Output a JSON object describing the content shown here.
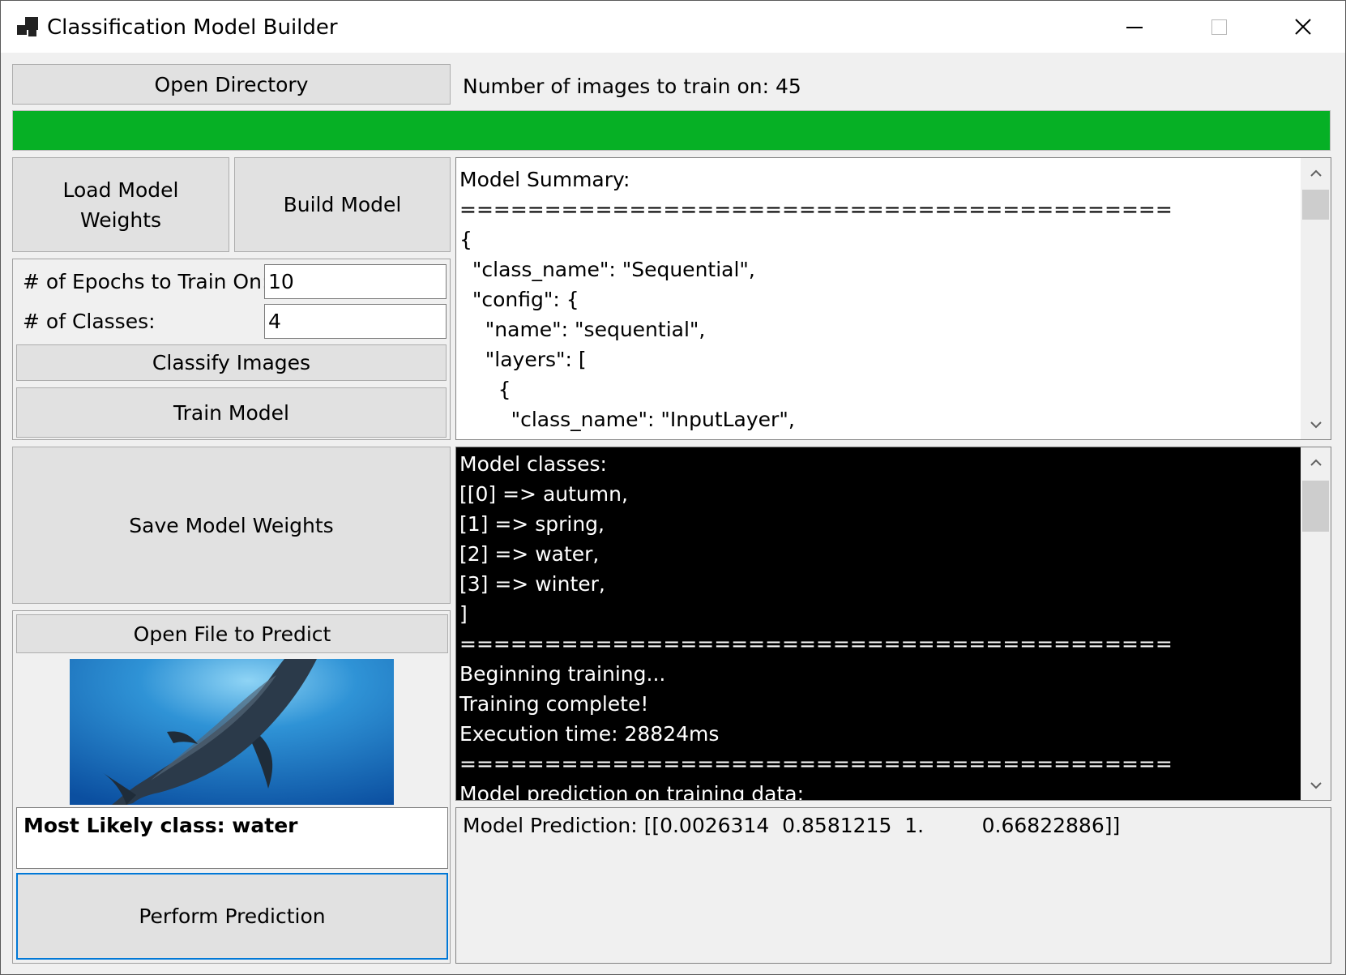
{
  "window": {
    "title": "Classification Model Builder"
  },
  "toolbar": {
    "open_directory": "Open Directory",
    "image_count_label": "Number of images to train on: 45"
  },
  "progress": {
    "value": 1.0,
    "color": "#06b025"
  },
  "buttons": {
    "load_weights": "Load Model Weights",
    "build_model": "Build Model",
    "classify_images": "Classify Images",
    "train_model": "Train Model",
    "save_weights": "Save Model Weights",
    "open_file_predict": "Open File to Predict",
    "perform_prediction": "Perform Prediction"
  },
  "settings": {
    "epochs_label": "# of Epochs to Train On:",
    "epochs_value": "10",
    "classes_label": "# of Classes:",
    "classes_value": "4"
  },
  "summary": {
    "lines": [
      "Model Summary:",
      "==========================================",
      "{",
      "  \"class_name\": \"Sequential\",",
      "  \"config\": {",
      "    \"name\": \"sequential\",",
      "    \"layers\": [",
      "      {",
      "        \"class_name\": \"InputLayer\","
    ]
  },
  "log": {
    "lines": [
      "Model classes:",
      "[[0] => autumn,",
      "[1] => spring,",
      "[2] => water,",
      "[3] => winter,",
      "]",
      "==========================================",
      "Beginning training...",
      "Training complete!",
      "Execution time: 28824ms",
      "==========================================",
      "Model prediction on training data:"
    ]
  },
  "prediction": {
    "result": "Most Likely class: water",
    "output": "Model Prediction: [[0.0026314  0.8581215  1.         0.66822886]]"
  },
  "colors": {
    "accent": "#0078d7",
    "progress": "#06b025",
    "log_bg": "#000000",
    "log_fg": "#ffffff"
  },
  "icons": {
    "app": "app-icon",
    "minimize": "minimize-icon",
    "maximize": "maximize-icon",
    "close": "close-icon"
  }
}
